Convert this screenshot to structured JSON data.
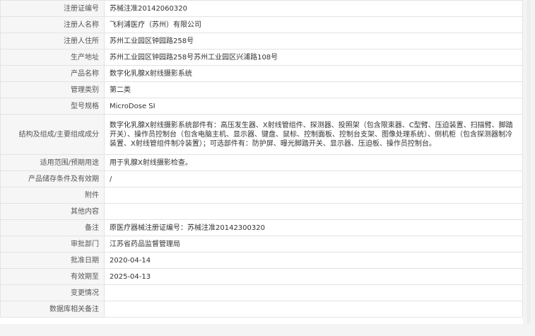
{
  "record": {
    "rows": [
      {
        "label": "注册证编号",
        "value": "苏械注准20142060320"
      },
      {
        "label": "注册人名称",
        "value": "飞利浦医疗（苏州）有限公司"
      },
      {
        "label": "注册人住所",
        "value": "苏州工业园区钟园路258号"
      },
      {
        "label": "生产地址",
        "value": "苏州工业园区钟园路258号苏州工业园区兴浦路108号"
      },
      {
        "label": "产品名称",
        "value": "数字化乳腺X射线摄影系统"
      },
      {
        "label": "管理类别",
        "value": "第二类"
      },
      {
        "label": "型号规格",
        "value": "MicroDose SI"
      },
      {
        "label": "结构及组成/主要组成成分",
        "value": "数字化乳腺X射线摄影系统部件有：高压发生器、X射线管组件、探测器、投照架（包含限束器、C型臂、压迫装置、扫描臂、脚踏开关）、操作员控制台（包含电脑主机、显示器、键盘、鼠标、控制面板、控制台支架、图像处理系统）、侧机柜（包含探测器制冷装置、X射线管组件制冷装置）；可选部件有：防护屏、曝光脚踏开关、显示器、压迫板、操作员控制台。"
      },
      {
        "label": "适用范围/预期用途",
        "value": "用于乳腺X射线摄影检查。"
      },
      {
        "label": "产品储存条件及有效期",
        "value": "/"
      },
      {
        "label": "附件",
        "value": ""
      },
      {
        "label": "其他内容",
        "value": ""
      },
      {
        "label": "备注",
        "value": "原医疗器械注册证编号：苏械注准20142300320"
      },
      {
        "label": "审批部门",
        "value": "江苏省药品监督管理局"
      },
      {
        "label": "批准日期",
        "value": "2020-04-14"
      },
      {
        "label": "有效期至",
        "value": "2025-04-13"
      },
      {
        "label": "变更情况",
        "value": ""
      },
      {
        "label": "数据库相关备注",
        "value": ""
      }
    ]
  }
}
